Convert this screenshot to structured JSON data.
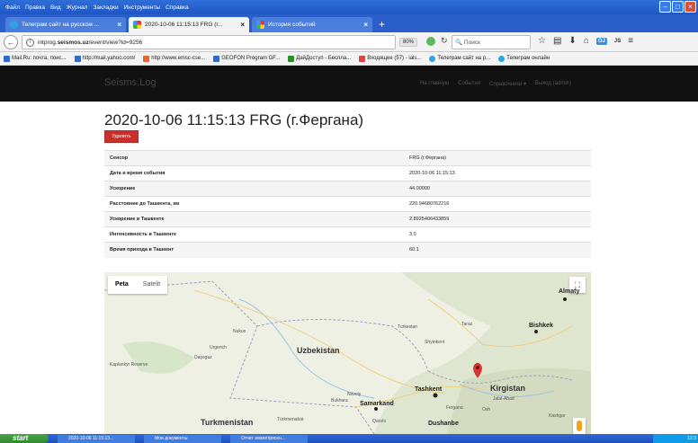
{
  "browser": {
    "menu": [
      "Файл",
      "Правка",
      "Вид",
      "Журнал",
      "Закладки",
      "Инструменты",
      "Справка"
    ],
    "tabs": [
      {
        "label": "Телеграм сайт на русском ..."
      },
      {
        "label": "2020-10-06 11:15:13 FRG (г..."
      },
      {
        "label": "История событий"
      }
    ],
    "url_prefix": "intprog.",
    "url_domain": "seismos.uz",
    "url_path": "/event/view?id=9256",
    "zoom": "80%",
    "search_placeholder": "Поиск",
    "ext_oj": "OJ",
    "ext_js": "JS",
    "bookmarks": [
      "Mail.Ru: почта, поис...",
      "http://mail.yahoo.com/",
      "http://www.emsc-cse...",
      "GEOFON Program GF...",
      "ДайДоступ - Беспла...",
      "Входящие (57) - ials...",
      "Телеграм сайт на р...",
      "Телеграм онлайн"
    ]
  },
  "site": {
    "brand": "Seisms.Log",
    "nav": [
      "На главную",
      "События",
      "Справочники ▾",
      "Выход (admin)"
    ]
  },
  "page": {
    "title": "2020-10-06 11:15:13 FRG (г.Фергана)",
    "delete_label": "Удалить",
    "rows": [
      {
        "key": "Сенсор",
        "value": "FRG (г.Фергана)"
      },
      {
        "key": "Дата и время события",
        "value": "2020-10-06 11:15:13"
      },
      {
        "key": "Ускорение",
        "value": "44.00000"
      },
      {
        "key": "Расстояние до Ташкента, км",
        "value": "220.94680762216"
      },
      {
        "key": "Ускорение в Ташкенте",
        "value": "2.8925406433859"
      },
      {
        "key": "Интенсивность в Ташкенте",
        "value": "3.0"
      },
      {
        "key": "Время прихода в Ташкент",
        "value": "60.1"
      }
    ]
  },
  "map": {
    "toggle_map": "Peta",
    "toggle_sat": "Satelit",
    "labels": {
      "uzbekistan": "Uzbekistan",
      "turkmenistan": "Turkmenistan",
      "kirgistan": "Kirgistan",
      "tashkent": "Tashkent",
      "samarkand": "Samarkand",
      "bishkek": "Bishkek",
      "almaty": "Almaty",
      "dushanbe": "Dushanbe",
      "nukus": "Nukus",
      "bukhara": "Bukhara",
      "shymkent": "Shymkent",
      "turkestan": "Turkestan",
      "taraz": "Taraz",
      "navoiy": "Navoiy",
      "fergana": "Fergana",
      "kaplankyr": "Kaplankyr Reserve",
      "turkmenabat": "Türkmenabat",
      "qarshi": "Qarshi",
      "jalalabad": "Jalal-Abad",
      "osh": "Osh",
      "kashgar": "Kashgar",
      "daşoguz": "Daşoguz",
      "urgench": "Urgench"
    }
  },
  "taskbar": {
    "start": "start",
    "tasks": [
      "2020-10-06 11:15:13...",
      "Мои документы",
      "Отчет землетрясен..."
    ],
    "clock": "12:3"
  }
}
